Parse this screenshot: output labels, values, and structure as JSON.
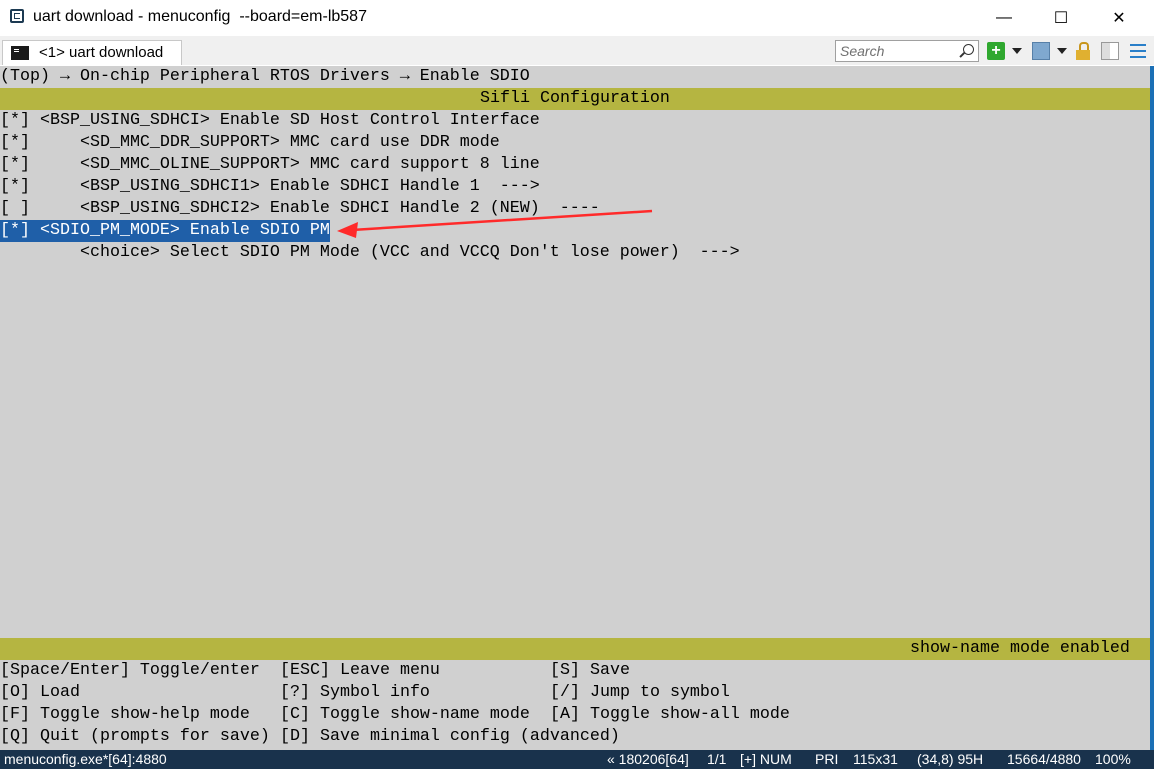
{
  "window": {
    "title": "uart download - menuconfig  --board=em-lb587",
    "app_icon": "console-icon",
    "controls": {
      "minimize": "—",
      "maximize": "☐",
      "close": "✕"
    }
  },
  "tab": {
    "label": "<1> uart download",
    "icon": "terminal-icon"
  },
  "toolbar": {
    "search_placeholder": "Search",
    "search_icon": "magnifier-icon",
    "add_label": "+",
    "icons": [
      "add-console-icon",
      "dropdown-arrow-icon",
      "view-icon",
      "dropdown-arrow-icon",
      "lock-icon",
      "split-pane-icon",
      "hamburger-menu-icon"
    ]
  },
  "terminal": {
    "breadcrumb": "(Top) → On-chip Peripheral RTOS Drivers → Enable SDIO",
    "header_title": "Sifli Configuration",
    "items": [
      "[*] <BSP_USING_SDHCI> Enable SD Host Control Interface",
      "[*]     <SD_MMC_DDR_SUPPORT> MMC card use DDR mode",
      "[*]     <SD_MMC_OLINE_SUPPORT> MMC card support 8 line",
      "[*]     <BSP_USING_SDHCI1> Enable SDHCI Handle 1  --->",
      "[ ]     <BSP_USING_SDHCI2> Enable SDHCI Handle 2 (NEW)  ----",
      "[*] <SDIO_PM_MODE> Enable SDIO PM",
      "        <choice> Select SDIO PM Mode (VCC and VCCQ Don't lose power)  --->"
    ],
    "selected_index": 5,
    "status_message": "show-name mode enabled",
    "help": {
      "col1": [
        "[Space/Enter] Toggle/enter",
        "[O] Load",
        "[F] Toggle show-help mode",
        "[Q] Quit (prompts for save)"
      ],
      "col2": [
        "[ESC] Leave menu",
        "[?] Symbol info",
        "[C] Toggle show-name mode",
        "[D] Save minimal config (advanced)"
      ],
      "col3": [
        "[S] Save",
        "[/] Jump to symbol",
        "[A] Toggle show-all mode"
      ]
    }
  },
  "annotation": {
    "color": "#ff2a2a"
  },
  "statusbar": {
    "process": "menuconfig.exe*[64]:4880",
    "build": "« 180206[64]",
    "page": "1/1",
    "plus": "[+] NUM",
    "priority": "PRI",
    "size": "115x31",
    "cursor": "(34,8) 95H",
    "pid": "15664/4880",
    "zoom": "100%"
  },
  "colors": {
    "terminal_bg": "#d0d0d0",
    "header_bar": "#b5b541",
    "selection": "#1f5fa8",
    "statusbar_bg": "#19324c"
  }
}
